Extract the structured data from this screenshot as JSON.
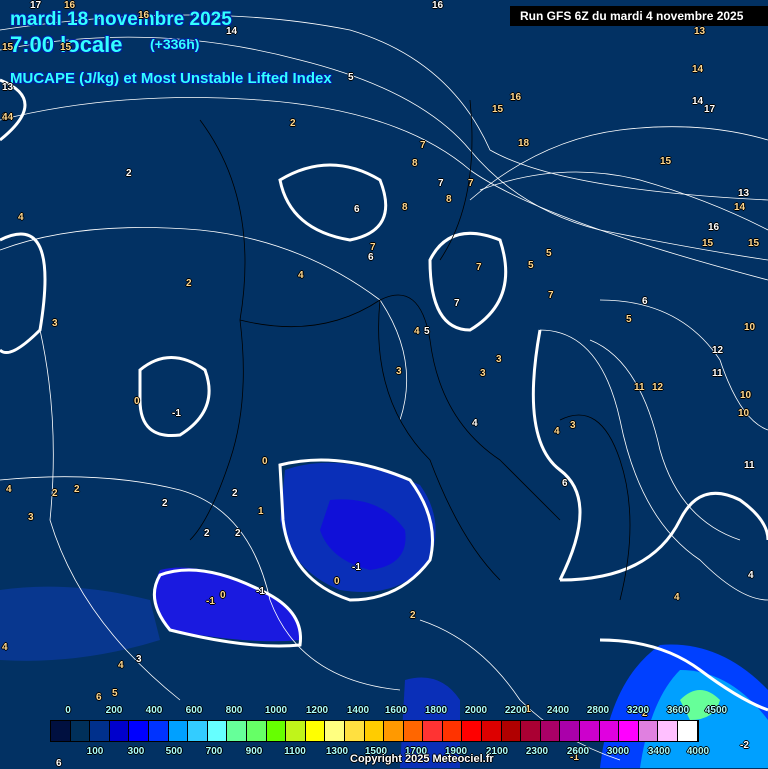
{
  "header": {
    "date": "mardi 18 novembre 2025",
    "time": "7:00 locale",
    "lead": "(+336h)",
    "parameter": "MUCAPE (J/kg) et Most Unstable Lifted Index",
    "run": "Run GFS 6Z du mardi 4 novembre 2025"
  },
  "colorbar": {
    "top_labels": [
      "0",
      "200",
      "400",
      "600",
      "800",
      "1000",
      "1200",
      "1400",
      "1600",
      "1800",
      "2000",
      "2200",
      "2400",
      "2800",
      "3200",
      "3600",
      "4500"
    ],
    "bottom_labels": [
      "100",
      "300",
      "500",
      "700",
      "900",
      "1100",
      "1300",
      "1500",
      "1700",
      "1900",
      "2100",
      "2300",
      "2600",
      "3000",
      "3400",
      "4000"
    ],
    "colors": [
      "#001040",
      "#00305a",
      "#00308c",
      "#0000cc",
      "#0000ff",
      "#0033ff",
      "#00a0ff",
      "#33ccff",
      "#66ffff",
      "#66ff99",
      "#66ff66",
      "#66ff00",
      "#c0f41a",
      "#ffff00",
      "#ffff80",
      "#ffe040",
      "#ffcc00",
      "#ff9900",
      "#ff6600",
      "#ff3333",
      "#ff3300",
      "#ff0000",
      "#dd0000",
      "#b00000",
      "#aa0033",
      "#aa0066",
      "#aa00aa",
      "#cc00cc",
      "#e000e0",
      "#ff00ff",
      "#e080e0",
      "#ffc0ff",
      "#ffffff"
    ]
  },
  "contour_labels": [
    "17",
    "16",
    "16",
    "14",
    "15",
    "15",
    "13",
    "14",
    "4",
    "16",
    "14",
    "13",
    "14",
    "15",
    "16",
    "17",
    "18",
    "15",
    "13",
    "14",
    "15",
    "16",
    "15",
    "3",
    "2",
    "2",
    "4",
    "5",
    "8",
    "7",
    "7",
    "7",
    "8",
    "6",
    "8",
    "7",
    "6",
    "4",
    "7",
    "7",
    "5",
    "5",
    "6",
    "5",
    "10",
    "12",
    "11",
    "12",
    "11",
    "10",
    "10",
    "11",
    "7",
    "4",
    "5",
    "3",
    "3",
    "4",
    "3",
    "4",
    "6",
    "3",
    "0",
    "-1",
    "2",
    "4",
    "2",
    "2",
    "2",
    "2",
    "1",
    "0",
    "2",
    "4",
    "3",
    "-1",
    "0",
    "-1",
    "-1",
    "0",
    "2",
    "2",
    "4",
    "4",
    "3",
    "6",
    "5",
    "6",
    "4",
    "-1",
    "-2",
    "2",
    "-1",
    "4"
  ],
  "copyright": "Copyright 2025 Meteociel.fr"
}
